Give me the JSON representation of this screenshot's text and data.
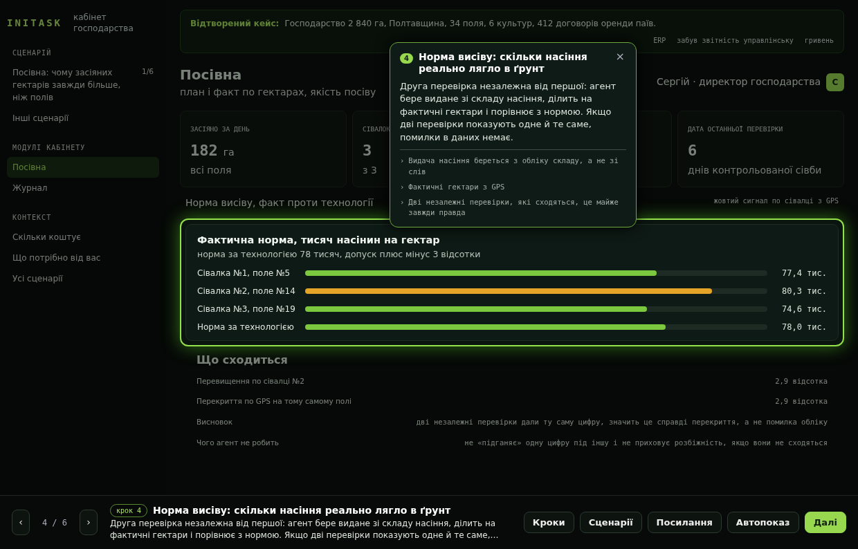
{
  "sidebar": {
    "logo": "INITASK",
    "subtitle": "кабінет господарства",
    "sections": [
      {
        "title": "СЦЕНАРІЙ",
        "items": [
          {
            "label": "Посівна: чому засіяних гектарів завжди більше, ніж полів",
            "count": "1/6",
            "selected": false
          },
          {
            "label": "Інші сценарії",
            "selected": false
          }
        ]
      },
      {
        "title": "МОДУЛІ КАБІНЕТУ",
        "items": [
          {
            "label": "Посівна",
            "selected": true
          },
          {
            "label": "Журнал",
            "selected": false
          }
        ]
      },
      {
        "title": "КОНТЕКСТ",
        "items": [
          {
            "label": "Скільки коштує",
            "selected": false
          },
          {
            "label": "Що потрібно від вас",
            "selected": false
          },
          {
            "label": "Усі сценарії",
            "selected": false
          }
        ]
      }
    ]
  },
  "banner": {
    "label": "Відтворений кейс:",
    "text": "Господарство 2 840 га, Полтавщина, 34 поля, 6 культур, 412 договорів оренди паїв.",
    "tags": [
      "ERP",
      "забув звітність управлінську",
      "гривень"
    ]
  },
  "header": {
    "title": "Посівна",
    "subtitle": "план і факт по гектарах, якість посіву",
    "user": "Сергій · директор господарства",
    "avatar": "С"
  },
  "stats": [
    {
      "label": "ЗАСІЯНО ЗА ДЕНЬ",
      "value": "182",
      "unit": "га",
      "note": "всі поля"
    },
    {
      "label": "СІВАЛОК",
      "value": "3",
      "note": "з 3"
    },
    {
      "kind": "covered"
    },
    {
      "label": "ДАТА ОСТАННЬОЇ ПЕРЕВІРКИ",
      "value": "6",
      "note": "днів контрольованої сівби"
    }
  ],
  "strip": {
    "title": "Норма висіву, факт проти технології",
    "note": "жовтий сигнал по сівалці з GPS"
  },
  "focus": {
    "title": "Фактична норма, тисяч насінин на гектар",
    "subtitle": "норма за технологією 78 тисяч, допуск плюс мінус 3 відсотки",
    "rows": [
      {
        "label": "Сівалка №1, поле №5",
        "level": 0.76,
        "value": "77,4 тис.",
        "color": "#7cc83e"
      },
      {
        "label": "Сівалка №2, поле №14",
        "level": 0.88,
        "value": "80,3 тис.",
        "color": "#e5a428"
      },
      {
        "label": "Сівалка №3, поле №19",
        "level": 0.74,
        "value": "74,6 тис.",
        "color": "#7cc83e"
      },
      {
        "label": "Норма за технологією",
        "level": 0.78,
        "value": "78,0 тис.",
        "color": "#7cc83e"
      }
    ]
  },
  "matches": {
    "title": "Що сходиться",
    "rows": [
      {
        "label": "Перевищення по сівалці №2",
        "value": "2,9 відсотка"
      },
      {
        "label": "Перекриття по GPS на тому самому полі",
        "value": "2,9 відсотка"
      },
      {
        "label": "Висновок",
        "value": "дві незалежні перевірки дали ту саму цифру, значить це справді перекриття, а не помилка обліку"
      },
      {
        "label": "Чого агент не робить",
        "value": "не «підганяє» одну цифру під іншу і не приховує розбіжність, якщо вони не сходяться"
      }
    ]
  },
  "popover": {
    "step": "4",
    "title": "Норма висіву: скільки насіння реально лягло в ґрунт",
    "close": "×",
    "body": "Друга перевірка незалежна від першої: агент бере видане зі складу насіння, ділить на фактичні гектари і порівнює з нормою. Якщо дві перевірки показують одне й те саме, помилки в даних немає.",
    "bullet_mark": "›",
    "bullets": [
      "Видача насіння береться з обліку складу, а не зі слів",
      "Фактичні гектари з GPS",
      "Дві незалежні перевірки, які сходяться, це майже завжди правда"
    ]
  },
  "tour_bar": {
    "prev": "‹",
    "counter": "4 / 6",
    "next": "›",
    "step_badge": "крок 4",
    "title": "Норма висіву: скільки насіння реально лягло в ґрунт",
    "text": "Друга перевірка незалежна від першої: агент бере видане зі складу насіння, ділить на фактичні гектари і порівнює з нормою. Якщо дві перевірки показують одне й те саме,…",
    "buttons": [
      {
        "label": "Кроки",
        "primary": false
      },
      {
        "label": "Сценарії",
        "primary": false
      },
      {
        "label": "Посилання",
        "primary": false
      },
      {
        "label": "Автопоказ",
        "primary": false
      },
      {
        "label": "Далі",
        "primary": true
      }
    ]
  }
}
